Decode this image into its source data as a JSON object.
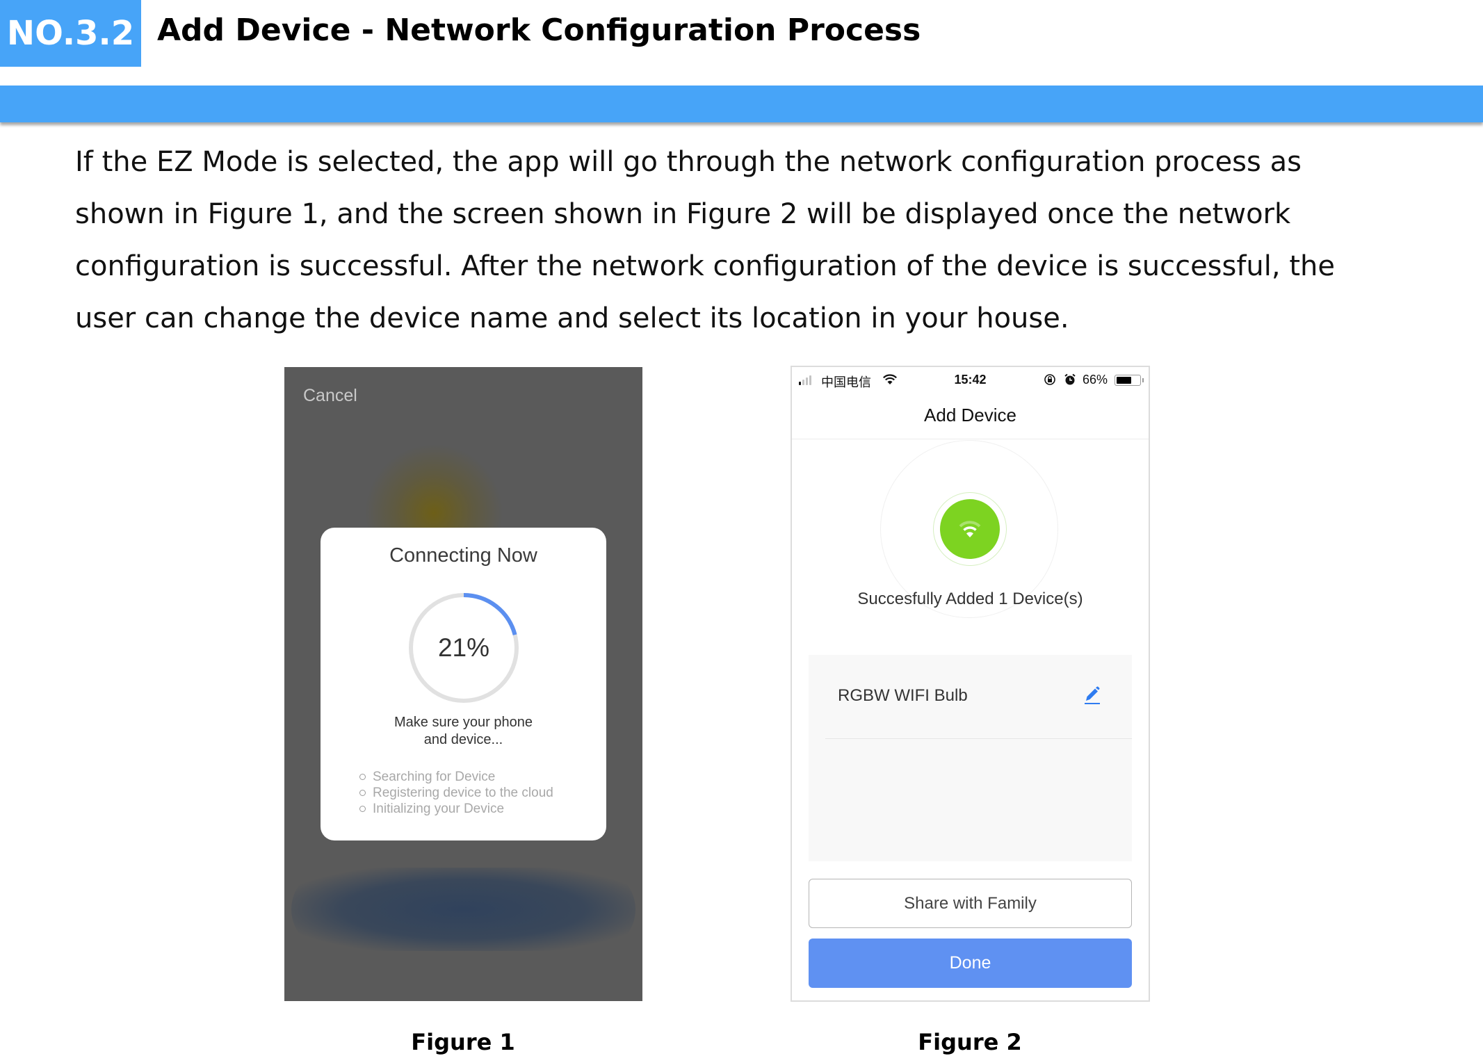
{
  "header": {
    "section_number": "NO.3.2",
    "title": "Add Device - Network Configuration Process",
    "accent_color": "#47a4f8"
  },
  "paragraph": {
    "lines": [
      "If the EZ Mode is selected, the app will go through the network configuration process as",
      "shown in Figure 1, and the screen shown in Figure 2 will be displayed once the network",
      "configuration is successful. After the network configuration of the device is successful, the",
      "user can change the device name and select its location in your house."
    ]
  },
  "figure1": {
    "caption": "Figure 1",
    "cancel_label": "Cancel",
    "card_title": "Connecting Now",
    "progress_percent": 21,
    "progress_label": "21%",
    "progress_color": "#5b8ff0",
    "message_line1": "Make sure your phone",
    "message_line2": "and device...",
    "steps": [
      "Searching for Device",
      "Registering device to the cloud",
      "Initializing your Device"
    ]
  },
  "figure2": {
    "caption": "Figure 2",
    "status_bar": {
      "carrier": "中国电信",
      "time": "15:42",
      "battery_percent_label": "66%",
      "battery_level": 0.66,
      "signal_bars_filled": 1,
      "signal_bars_total": 4
    },
    "title": "Add Device",
    "success_message": "Succesfully Added 1 Device(s)",
    "success_color": "#7dd321",
    "device_name": "RGBW WIFI Bulb",
    "share_button_label": "Share with Family",
    "done_button_label": "Done",
    "done_color": "#5f91f2"
  }
}
